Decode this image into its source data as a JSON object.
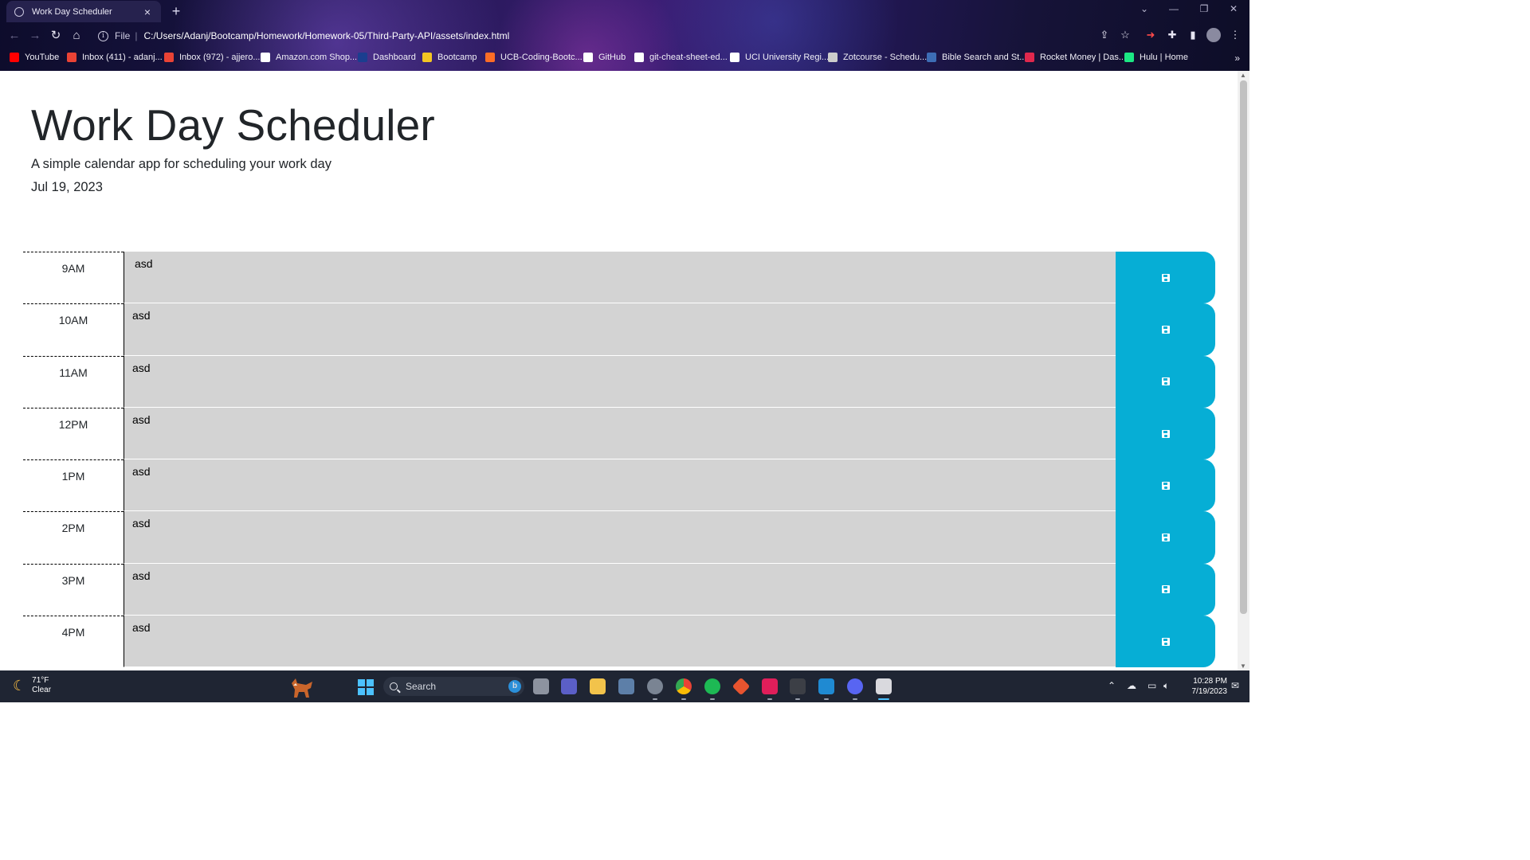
{
  "browser": {
    "tab_title": "Work Day Scheduler",
    "new_tab": "+",
    "address_scheme": "File",
    "address_url": "C:/Users/Adanj/Bootcamp/Homework/Homework-05/Third-Party-API/assets/index.html",
    "bookmarks": [
      {
        "label": "YouTube",
        "color": "#ff0000"
      },
      {
        "label": "Inbox (411) - adanj...",
        "color": "#ea4335"
      },
      {
        "label": "Inbox (972) - ajjero...",
        "color": "#ea4335"
      },
      {
        "label": "Amazon.com Shop...",
        "color": "#ffffff"
      },
      {
        "label": "Dashboard",
        "color": "#1b3e8f"
      },
      {
        "label": "Bootcamp",
        "color": "#f3c623"
      },
      {
        "label": "UCB-Coding-Bootc...",
        "color": "#fc6d26"
      },
      {
        "label": "GitHub",
        "color": "#ffffff"
      },
      {
        "label": "git-cheat-sheet-ed...",
        "color": "#ffffff"
      },
      {
        "label": "UCI University Regi...",
        "color": "#ffffff"
      },
      {
        "label": "Zotcourse - Schedu...",
        "color": "#cccccc"
      },
      {
        "label": "Bible Search and St...",
        "color": "#3d6db5"
      },
      {
        "label": "Rocket Money | Das...",
        "color": "#e0284d"
      },
      {
        "label": "Hulu | Home",
        "color": "#1ce783"
      }
    ],
    "more_bookmarks": "»"
  },
  "page": {
    "title": "Work Day Scheduler",
    "lead": "A simple calendar app for scheduling your work day",
    "current_date": "Jul 19, 2023",
    "rows": [
      {
        "hour": "9AM",
        "text": "asd"
      },
      {
        "hour": "10AM",
        "text": "asd"
      },
      {
        "hour": "11AM",
        "text": "asd"
      },
      {
        "hour": "12PM",
        "text": "asd"
      },
      {
        "hour": "1PM",
        "text": "asd"
      },
      {
        "hour": "2PM",
        "text": "asd"
      },
      {
        "hour": "3PM",
        "text": "asd"
      },
      {
        "hour": "4PM",
        "text": "asd"
      }
    ],
    "colors": {
      "description_bg": "#d3d3d3",
      "save_button": "#06aed5"
    }
  },
  "taskbar": {
    "weather_temp": "71°F",
    "weather_cond": "Clear",
    "search_placeholder": "Search",
    "time": "10:28 PM",
    "date": "7/19/2023"
  }
}
